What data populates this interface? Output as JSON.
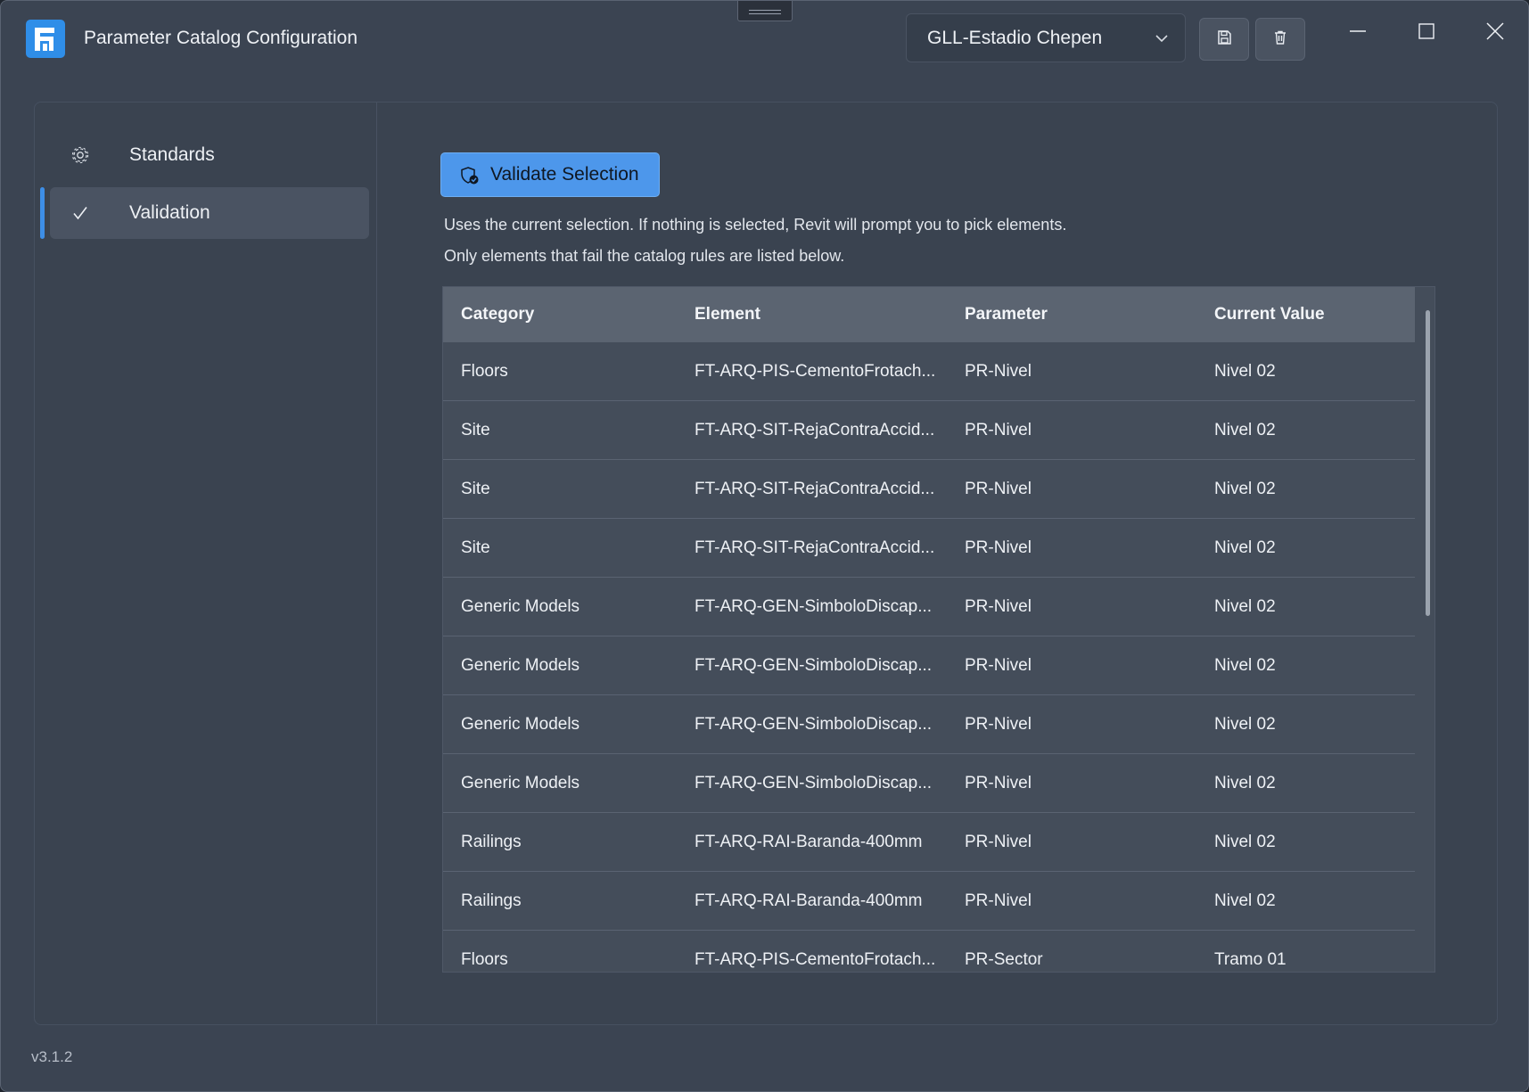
{
  "app": {
    "title": "Parameter Catalog Configuration",
    "version": "v3.1.2",
    "accent_color": "#4d97eb"
  },
  "header": {
    "project_select": {
      "value": "GLL-Estadio Chepen"
    },
    "save_icon": "save-icon",
    "delete_icon": "trash-icon"
  },
  "sidebar": {
    "items": [
      {
        "label": "Standards",
        "icon": "gear-icon",
        "active": false
      },
      {
        "label": "Validation",
        "icon": "check-icon",
        "active": true
      }
    ]
  },
  "main": {
    "validate_button": "Validate Selection",
    "description_1": "Uses the current selection. If nothing is selected, Revit will prompt you to pick elements.",
    "description_2": "Only elements that fail the catalog rules are listed below.",
    "table": {
      "columns": [
        "Category",
        "Element",
        "Parameter",
        "Current Value"
      ],
      "rows": [
        [
          "Floors",
          "FT-ARQ-PIS-CementoFrotach...",
          "PR-Nivel",
          "Nivel 02"
        ],
        [
          "Site",
          "FT-ARQ-SIT-RejaContraAccid...",
          "PR-Nivel",
          "Nivel 02"
        ],
        [
          "Site",
          "FT-ARQ-SIT-RejaContraAccid...",
          "PR-Nivel",
          "Nivel 02"
        ],
        [
          "Site",
          "FT-ARQ-SIT-RejaContraAccid...",
          "PR-Nivel",
          "Nivel 02"
        ],
        [
          "Generic Models",
          "FT-ARQ-GEN-SimboloDiscap...",
          "PR-Nivel",
          "Nivel 02"
        ],
        [
          "Generic Models",
          "FT-ARQ-GEN-SimboloDiscap...",
          "PR-Nivel",
          "Nivel 02"
        ],
        [
          "Generic Models",
          "FT-ARQ-GEN-SimboloDiscap...",
          "PR-Nivel",
          "Nivel 02"
        ],
        [
          "Generic Models",
          "FT-ARQ-GEN-SimboloDiscap...",
          "PR-Nivel",
          "Nivel 02"
        ],
        [
          "Railings",
          "FT-ARQ-RAI-Baranda-400mm",
          "PR-Nivel",
          "Nivel 02"
        ],
        [
          "Railings",
          "FT-ARQ-RAI-Baranda-400mm",
          "PR-Nivel",
          "Nivel 02"
        ],
        [
          "Floors",
          "FT-ARQ-PIS-CementoFrotach...",
          "PR-Sector",
          "Tramo 01"
        ]
      ]
    }
  }
}
